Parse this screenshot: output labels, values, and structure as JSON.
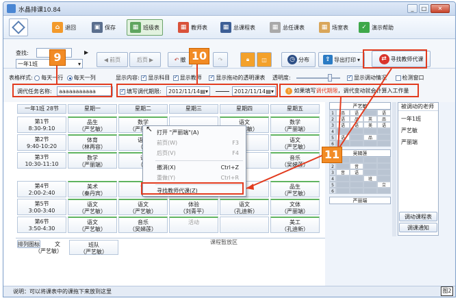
{
  "window": {
    "title": "水晶排课10.84"
  },
  "toolbar": {
    "back": "退回",
    "save": "保存",
    "class_table": "班级表",
    "teacher_table": "教师表",
    "total_table": "总课程表",
    "total_teacher_table": "总任课表",
    "room_table": "场室表",
    "help": "演示帮助"
  },
  "nav": {
    "search_label": "查找:",
    "class_select": "一年1班",
    "prev_page": "前页",
    "next_page": "后页",
    "undo_partial": "撤",
    "distribute": "分布",
    "export_print": "导出打印",
    "find_substitute": "寻找教师代课"
  },
  "options": {
    "style_label": "表格样式:",
    "style_row": "每天一行",
    "style_col": "每天一列",
    "show_label": "显示内容:",
    "show_class": "显示科目",
    "show_teacher": "显示教师",
    "show_transparent": "显示拖动的透明课表",
    "opacity_label": "透明度:",
    "show_adjust": "显示调动情况",
    "check_window": "检测窗口",
    "task_name_label": "调代任务名称:",
    "task_name_value": "aaaaaaaaaaa",
    "fill_period": "填写调代期限:",
    "date_from": "2012/11/14",
    "date_to": "2012/11/14",
    "hint_prefix": "如果填写",
    "hint_red": "调代期限",
    "hint_suffix": "，调代变动就会计算入工作量"
  },
  "timetable": {
    "corner": "一年1班 28节",
    "days": [
      "星期一",
      "星期二",
      "星期三",
      "星期四",
      "星期五"
    ],
    "periods": [
      {
        "name": "第1节",
        "time": "8:30-9:10"
      },
      {
        "name": "第2节",
        "time": "9:40-10:20"
      },
      {
        "name": "第3节",
        "time": "10:30-11:10"
      },
      {
        "name": "第4节",
        "time": "2:00-2:40"
      },
      {
        "name": "第5节",
        "time": "3:00-3:40"
      },
      {
        "name": "第6节",
        "time": "3:50-4:30"
      }
    ],
    "cells": [
      [
        {
          "s": "品生",
          "t": "（严艺敏）"
        },
        {
          "s": "数学",
          "t": "（严丽端）"
        },
        {
          "s": "",
          "t": ""
        },
        {
          "s": "语文",
          "t": "（严艺敏）"
        },
        {
          "s": "数学",
          "t": "（严丽端）"
        }
      ],
      [
        {
          "s": "体育",
          "t": "（林再容）"
        },
        {
          "s": "语文",
          "t": "（刘"
        },
        {
          "s": "",
          "t": ""
        },
        {
          "s": "",
          "t": ""
        },
        {
          "s": "语文",
          "t": "（严艺敏）"
        }
      ],
      [
        {
          "s": "数学",
          "t": "（严丽端）"
        },
        {
          "s": "语",
          "t": "（严"
        },
        {
          "s": "",
          "t": ""
        },
        {
          "s": "",
          "t": ""
        },
        {
          "s": "音乐",
          "t": "（吴娣莲）"
        }
      ],
      [
        {
          "s": "美术",
          "t": "（秦丹宾）"
        },
        {
          "s": "语",
          "t": "（严"
        },
        {
          "s": "",
          "t": ""
        },
        {
          "s": "",
          "t": ""
        },
        {
          "s": "品生",
          "t": "（严艺敏）"
        }
      ],
      [
        {
          "s": "语文",
          "t": "（严艺敏）"
        },
        {
          "s": "语文",
          "t": "（严艺敏）"
        },
        {
          "s": "体验",
          "t": "（刘青平）"
        },
        {
          "s": "语文",
          "t": "（孔迪新）"
        },
        {
          "s": "文体",
          "t": "（严丽端）"
        }
      ],
      [
        {
          "s": "语文",
          "t": "（严艺敏）"
        },
        {
          "s": "音乐",
          "t": "（吴娣莲）"
        },
        {
          "s": "活动",
          "t": ""
        },
        {
          "s": "",
          "t": ""
        },
        {
          "s": "美工",
          "t": "（孔迪新）"
        }
      ]
    ],
    "staging_label": "课程暂放区",
    "extra_tabs": [
      "排列图标",
      "文"
    ],
    "staged": [
      {
        "s": "语文",
        "t": "（严艺敏）"
      },
      {
        "s": "班队",
        "t": "（严艺敏）"
      }
    ]
  },
  "context_menu": {
    "items": [
      {
        "label": "打开 \"严丽端\"(A)",
        "key": ""
      },
      {
        "label": "前页(W)",
        "key": "F3"
      },
      {
        "label": "后页(V)",
        "key": "F4"
      },
      {
        "label": "撤消(X)",
        "key": "Ctrl+Z"
      },
      {
        "label": "重做(Y)",
        "key": "Ctrl+R"
      },
      {
        "label": "寻找教师代课(Z)",
        "key": ""
      }
    ]
  },
  "mini_tables": [
    {
      "title": "严艺敏",
      "rows": [
        [
          "品",
          "语",
          "",
          "语"
        ],
        [
          "语",
          "品",
          "英",
          "品"
        ],
        [
          "语",
          "语",
          "美",
          "语"
        ],
        [
          "",
          "",
          "",
          ""
        ],
        [
          "语",
          "",
          "品",
          ""
        ],
        [
          "",
          "",
          "",
          ""
        ]
      ]
    },
    {
      "title": "吴娣莲",
      "rows": [
        [
          "",
          "",
          "",
          ""
        ],
        [
          "",
          "音",
          "",
          ""
        ],
        [
          "音",
          "语",
          "",
          ""
        ],
        [
          "",
          "",
          "班",
          ""
        ],
        [
          "",
          "",
          "",
          "立"
        ],
        [
          "",
          "",
          "",
          ""
        ]
      ]
    },
    {
      "title": "严丽端",
      "rows": []
    }
  ],
  "right_panel": {
    "title": "被调动的老师",
    "teachers": [
      "一年1班",
      "严艺敏",
      "严丽端"
    ],
    "adjust_btn": "调动课程表",
    "notice_btn": "调课通知"
  },
  "callouts": {
    "c9": "9",
    "c10": "10",
    "c11": "11"
  },
  "status": {
    "text": "说明：可以将课表中的课拖下来放到这里"
  },
  "figure_tag": "图2",
  "colors": {
    "accent_red": "#e23b1e",
    "callout": "#f28b25",
    "green": "#5fb35f"
  }
}
